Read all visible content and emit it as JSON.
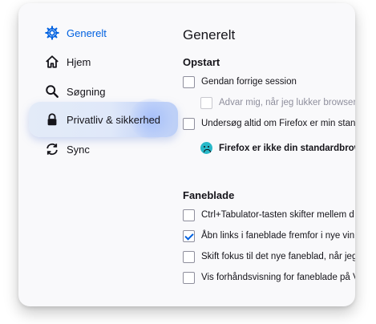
{
  "sidebar": {
    "items": [
      {
        "label": "Generelt",
        "icon": "gear-icon"
      },
      {
        "label": "Hjem",
        "icon": "home-icon"
      },
      {
        "label": "Søgning",
        "icon": "search-icon"
      },
      {
        "label": "Privatliv & sikkerhed",
        "icon": "lock-icon"
      },
      {
        "label": "Sync",
        "icon": "sync-icon"
      }
    ]
  },
  "main": {
    "title": "Generelt",
    "startup": {
      "heading": "Opstart",
      "restore_session": {
        "label": "Gendan forrige session",
        "checked": false
      },
      "warn_on_close": {
        "label": "Advar mig, når jeg lukker browser",
        "checked": false,
        "disabled": true
      },
      "check_default": {
        "label": "Undersøg altid om Firefox er min stan",
        "checked": false
      },
      "default_warning": "Firefox er ikke din standardbrow"
    },
    "tabs": {
      "heading": "Faneblade",
      "ctrl_tab": {
        "label": "Ctrl+Tabulator-tasten skifter mellem d",
        "checked": false
      },
      "open_links": {
        "label": "Åbn links i faneblade fremfor i nye vin",
        "checked": true
      },
      "switch_focus": {
        "label": "Skift fokus til det nye faneblad, når jeg",
        "checked": false
      },
      "tab_previews": {
        "label": "Vis forhåndsvisning for faneblade på V",
        "checked": false
      }
    }
  },
  "colors": {
    "accent": "#0061e0",
    "warning_face": "#28b8c8"
  }
}
